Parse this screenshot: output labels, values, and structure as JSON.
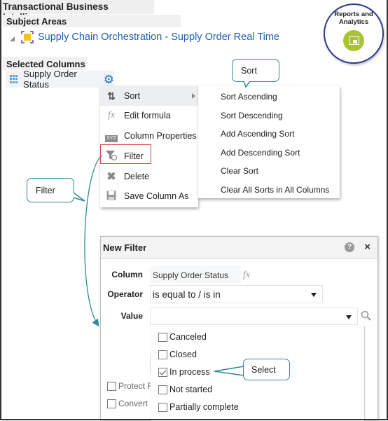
{
  "app_title": "Transactional Business Intelligence",
  "subject_areas": {
    "header": "Subject Areas",
    "items": [
      {
        "label": "Supply Chain Orchestration - Supply Order Real Time",
        "icon": "subject-area-icon"
      }
    ]
  },
  "selected_columns": {
    "header": "Selected Columns",
    "items": [
      {
        "label": "Supply Order Status",
        "icon": "column-icon",
        "options_icon": "gear-icon"
      }
    ]
  },
  "badge": {
    "label": "Reports and Analytics",
    "icon": "reports-icon",
    "color": "#a8c432"
  },
  "context_menu": {
    "items": [
      {
        "label": "Sort",
        "icon": "sort-icon",
        "has_submenu": true,
        "active": true
      },
      {
        "label": "Edit formula",
        "icon": "fx-icon"
      },
      {
        "label": "Column Properties",
        "icon": "column-properties-icon"
      },
      {
        "label": "Filter",
        "icon": "filter-icon",
        "highlighted": true
      },
      {
        "label": "Delete",
        "icon": "delete-icon"
      },
      {
        "label": "Save Column As",
        "icon": "save-icon"
      }
    ]
  },
  "sort_submenu": {
    "items": [
      "Sort Ascending",
      "Sort Descending",
      "Add Ascending Sort",
      "Add Descending Sort",
      "Clear Sort",
      "Clear All Sorts in All Columns"
    ]
  },
  "callouts": {
    "sort": "Sort",
    "filter": "Filter",
    "select": "Select",
    "color": "#2c8a9a"
  },
  "new_filter_dialog": {
    "title": "New Filter",
    "help_icon": "?",
    "close_icon": "×",
    "column_label": "Column",
    "column_value": "Supply Order Status",
    "column_fx": "fx",
    "operator_label": "Operator",
    "operator_value": "is equal to / is in",
    "value_label": "Value",
    "value_value": "",
    "value_options": [
      {
        "label": "Canceled",
        "checked": false
      },
      {
        "label": "Closed",
        "checked": false
      },
      {
        "label": "In process",
        "checked": true
      },
      {
        "label": "Not started",
        "checked": false
      },
      {
        "label": "Partially complete",
        "checked": false
      }
    ],
    "checkboxes": [
      {
        "label": "Protect Filter",
        "visible_text": "Protect F",
        "checked": false
      },
      {
        "label": "Convert this filter to SQL",
        "visible_text": "Convert t",
        "checked": false
      }
    ]
  },
  "highlight_color": "#d64b4b",
  "link_color": "#1f5fb3"
}
